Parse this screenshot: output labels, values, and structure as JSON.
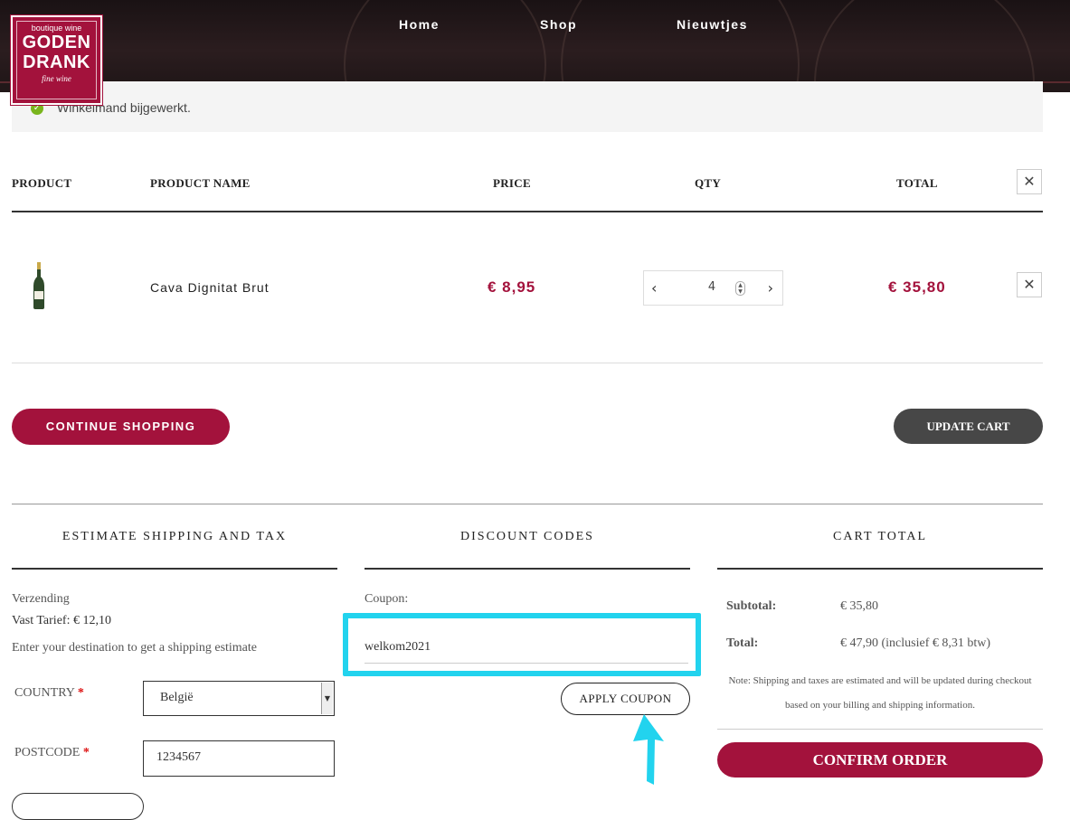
{
  "brand": {
    "line1": "boutique wine",
    "line2a": "GODEN",
    "line2b": "DRANK",
    "line3": "fine wine",
    "color": "#a3123c"
  },
  "nav": {
    "items": [
      "Home",
      "Shop",
      "Nieuwtjes"
    ]
  },
  "notice": {
    "message": "Winkelmand bijgewerkt.",
    "icon": "check-circle-icon"
  },
  "cart_table": {
    "headers": {
      "product": "PRODUCT",
      "name": "PRODUCT NAME",
      "price": "PRICE",
      "qty": "QTY",
      "total": "TOTAL"
    },
    "rows": [
      {
        "name": "Cava Dignitat Brut",
        "price": "€ 8,95",
        "qty": "4",
        "total": "€ 35,80"
      }
    ]
  },
  "actions": {
    "continue_label": "CONTINUE SHOPPING",
    "update_label": "UPDATE CART"
  },
  "shipping": {
    "title": "ESTIMATE SHIPPING AND TAX",
    "method": "Verzending",
    "rate": "Vast Tarief: € 12,10",
    "hint": "Enter your destination to get a shipping estimate",
    "country_label": "COUNTRY",
    "country_value": "België",
    "postcode_label": "POSTCODE",
    "postcode_value": "1234567",
    "required_mark": "*"
  },
  "discount": {
    "title": "DISCOUNT CODES",
    "coupon_label": "Coupon:",
    "coupon_value": "welkom2021",
    "apply_label": "APPLY COUPON",
    "highlight_color": "#22d3ee"
  },
  "totals": {
    "title": "CART TOTAL",
    "subtotal_label": "Subtotal:",
    "subtotal_value": "€ 35,80",
    "total_label": "Total:",
    "total_value": "€ 47,90 (inclusief € 8,31 btw)",
    "note": "Note: Shipping and taxes are estimated and will be updated during checkout based on your billing and shipping information.",
    "confirm_label": "CONFIRM ORDER"
  }
}
